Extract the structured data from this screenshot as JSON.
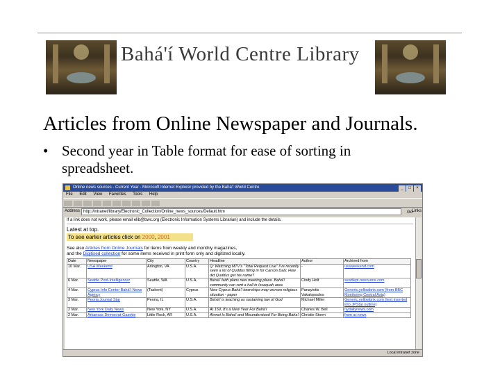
{
  "banner": {
    "title": "Bahá'í World Centre Library"
  },
  "slide": {
    "heading": "Articles from Online Newspaper and Journals.",
    "bullet_symbol": "•",
    "bullet_text": "Second year in Table format for ease of sorting in spreadsheet."
  },
  "browser": {
    "window_title": "Online news sources - Current Year - Microsoft Internet Explorer provided by the Bahá'í World Centre",
    "menu": [
      "File",
      "Edit",
      "View",
      "Favorites",
      "Tools",
      "Help"
    ],
    "address_label": "Address",
    "address_value": "http://intranet/library/Electronic_Collection/Online_news_sources/Default.htm",
    "go_label": "Go",
    "links_label": "Links",
    "notice": "If a link does not work, please email elib@bwc.org (Electronic Information Systems Librarian) and include the details.",
    "latest": "Latest at top.",
    "todo_prefix": "To see earlier articles click on ",
    "todo_year1": "2000",
    "todo_sep": ", ",
    "todo_year2": "2001",
    "seealso_line1_a": "See also ",
    "seealso_line1_link": "Articles from Online Journals",
    "seealso_line1_b": " for items from weekly and monthly magazines,",
    "seealso_line2_a": "and the ",
    "seealso_line2_link": "Digitised collection",
    "seealso_line2_b": " for some items received in print form only and digitized locally.",
    "table": {
      "headers": [
        "Date",
        "Newspaper",
        "City",
        "Country",
        "Headline",
        "Author",
        "Archived from"
      ],
      "rows": [
        [
          "10 Mar.",
          "USA Weekend",
          "Arlington, VA",
          "U.S.A.",
          "Q: Watching MTV's \"Total Request Live\" I've recently seen a lot of Quddus filling in for Carson Daly. How did Quddus get his name?",
          "-",
          "usaweekend.com"
        ],
        [
          "6 Mar.",
          "Seattle Post-Intelligencer",
          "Seattle, WA",
          "U.S.A.",
          "Bahá'í faith plans new meeting place. Bahá'í community can rent a hall in Issaquah area",
          "Cindy Holt",
          "seattlepi.nwsource.com"
        ],
        [
          "4 Mar.",
          "Cyprus Info Center Bahá'í News Agency",
          "(Taskent)",
          "Cyprus",
          "New Cyprus Bahá'í townships may worsen religious situation - paper",
          "Panayiotis Vakalopoulos",
          "Generic.yellowbrix.com (from BBC Monitoring Central Asia)"
        ],
        [
          "3 Mar.",
          "Peoria Journal Star",
          "Peoria, IL",
          "U.S.A.",
          "Bahá'í is teaching as sustaining law of God",
          "Michael Miller",
          "Generic.yellowbrix.com (text inserted into JPStar outline)"
        ],
        [
          "2 Mar.",
          "New York Daily News",
          "New York, NY",
          "U.S.A.",
          "At 159, It's a New Year For Bahá'í",
          "Charles W. Bell",
          "nydailynews.com"
        ],
        [
          "2 Mar.",
          "Arkansas Democrat-Gazette",
          "Little Rock, AR",
          "U.S.A.",
          "Ahmet Is Baha'i and Misunderstood For Being Baha'i",
          "Christie Storm",
          "from ar.news"
        ]
      ]
    },
    "status": "Local intranet zone"
  }
}
